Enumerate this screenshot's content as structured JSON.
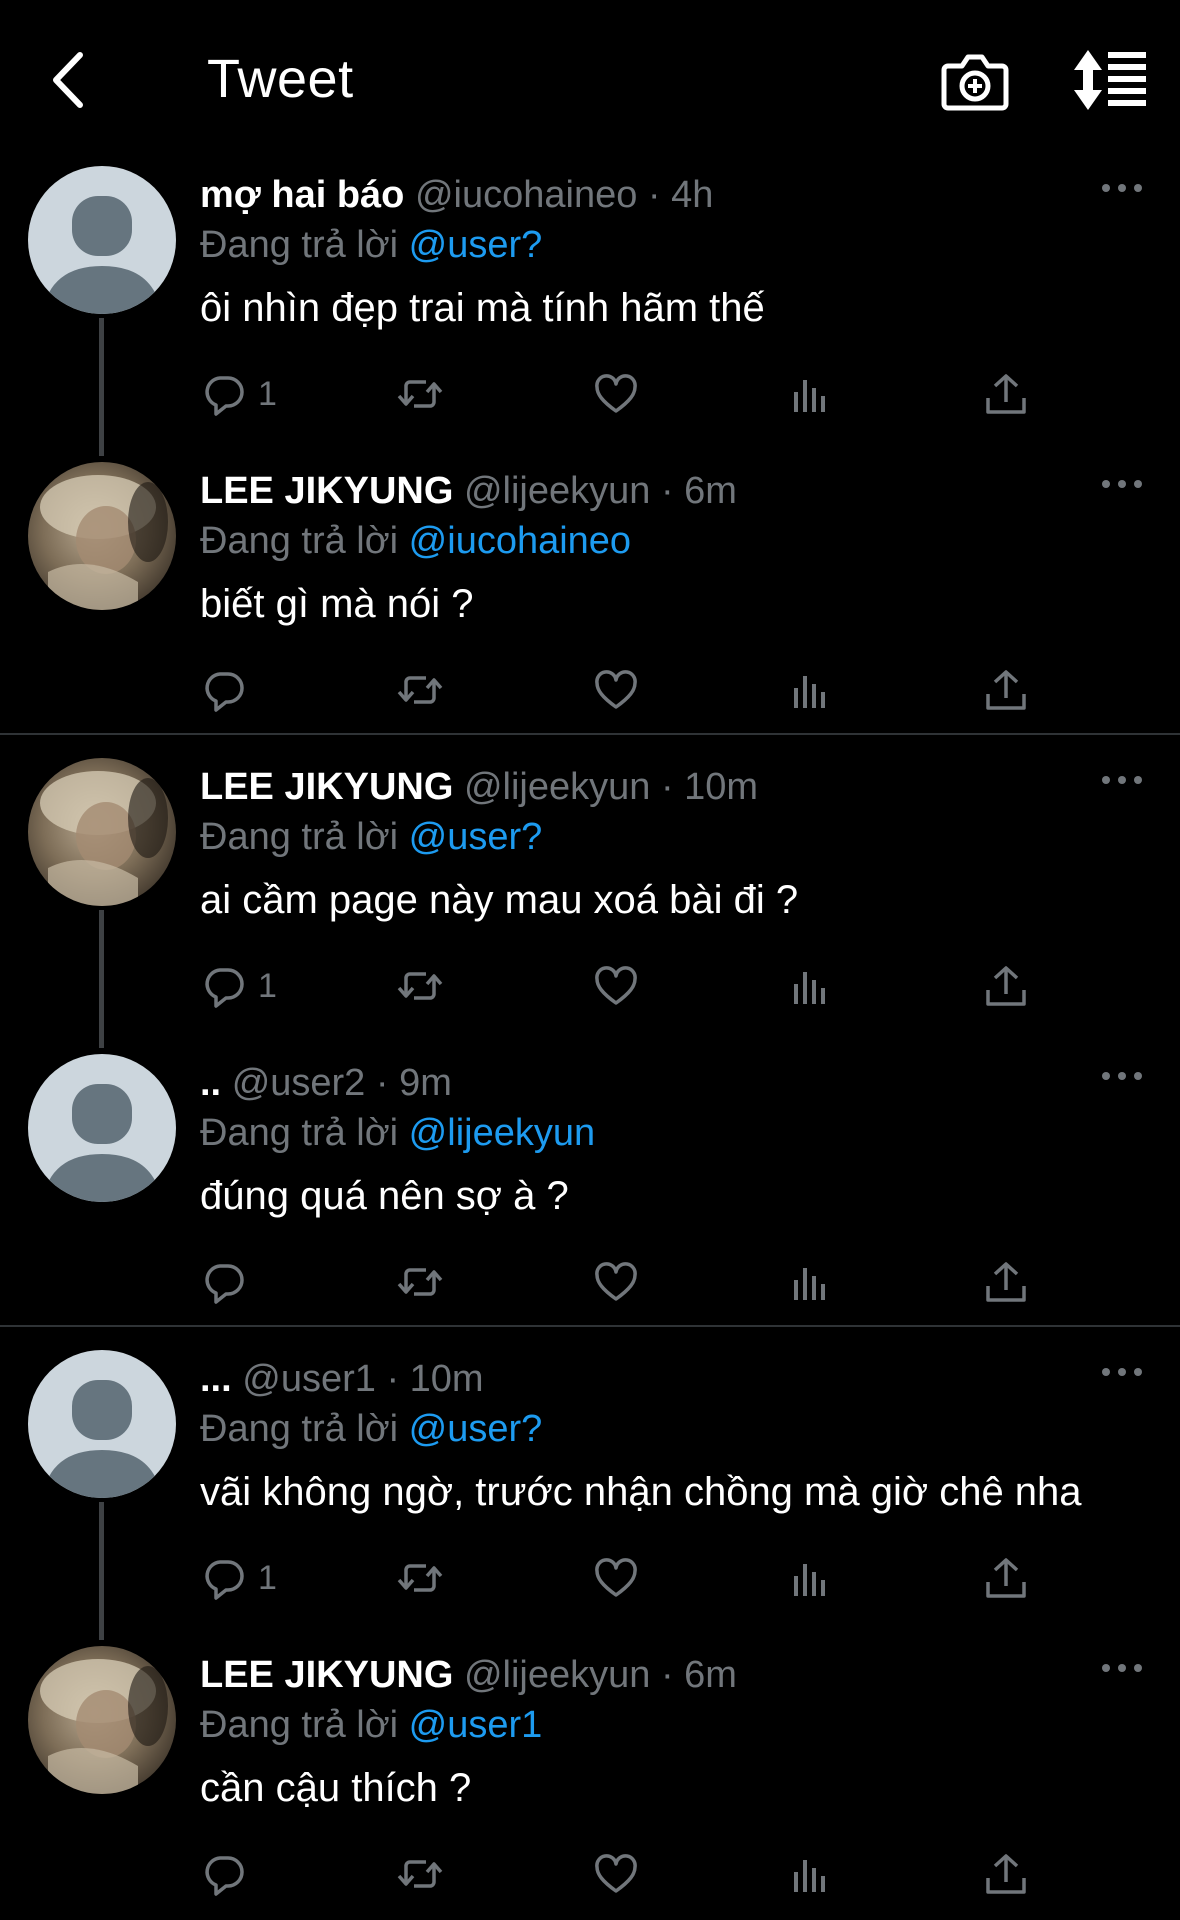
{
  "header": {
    "title": "Tweet"
  },
  "reply_prefix": "Đang trả lời",
  "tweets": [
    {
      "name": "mợ hai báo",
      "handle": "@iucohaineo",
      "time": "· 4h",
      "reply_to": "@user?",
      "text": "ôi nhìn đẹp trai mà tính hãm thế",
      "reply_count": "1",
      "avatar": "default"
    },
    {
      "name": "LEE JIKYUNG",
      "handle": "@lijeekyun",
      "time": "· 6m",
      "reply_to": "@iucohaineo",
      "text": "biết gì mà nói ?",
      "reply_count": "",
      "avatar": "photo"
    },
    {
      "name": "LEE JIKYUNG",
      "handle": "@lijeekyun",
      "time": "· 10m",
      "reply_to": "@user?",
      "text": "ai cầm page này mau xoá bài đi ?",
      "reply_count": "1",
      "avatar": "photo"
    },
    {
      "name": "..",
      "handle": "@user2",
      "time": "· 9m",
      "reply_to": "@lijeekyun",
      "text": "đúng quá nên sợ à ?",
      "reply_count": "",
      "avatar": "default"
    },
    {
      "name": "...",
      "handle": "@user1",
      "time": "· 10m",
      "reply_to": "@user?",
      "text": "vãi không ngờ, trước nhận chồng mà giờ chê nha",
      "reply_count": "1",
      "avatar": "default"
    },
    {
      "name": "LEE JIKYUNG",
      "handle": "@lijeekyun",
      "time": "· 6m",
      "reply_to": "@user1",
      "text": "cần cậu thích ?",
      "reply_count": "",
      "avatar": "photo"
    }
  ],
  "colors": {
    "background": "#000000",
    "mention": "#1d9bf0",
    "muted": "#71767b",
    "divider": "#2f3336"
  }
}
